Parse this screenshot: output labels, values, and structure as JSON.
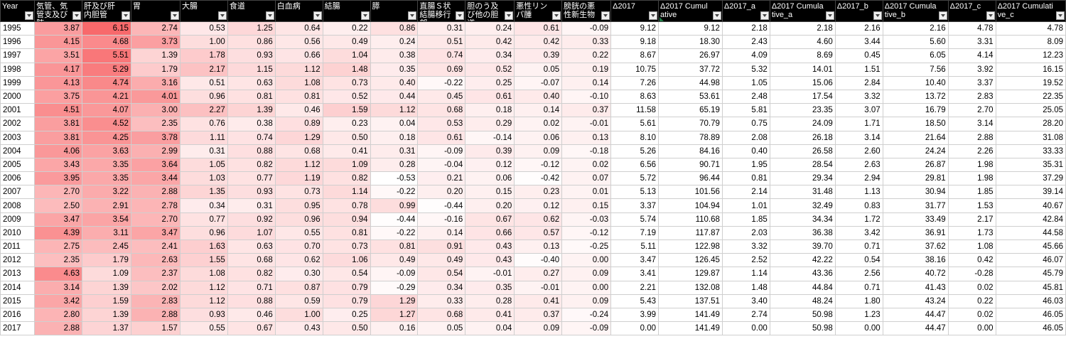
{
  "headers": [
    "Year",
    "気管、気管支及び肺",
    "肝及び肝内胆管",
    "胃",
    "大腸",
    "食道",
    "白血病",
    "結腸",
    "膵",
    "直腸Ｓ状結腸移行部",
    "胆のう及び他の胆道",
    "悪性リンパ腫",
    "膀胱の悪性新生物",
    "Δ2017",
    "Δ2017 Cumulative",
    "Δ2017_a",
    "Δ2017 Cumulative_a",
    "Δ2017_b",
    "Δ2017 Cumulative_b",
    "Δ2017_c",
    "Δ2017 Cumulative_c"
  ],
  "rows": [
    [
      "1995",
      "3.87",
      "6.15",
      "2.74",
      "0.53",
      "1.25",
      "0.64",
      "0.22",
      "0.86",
      "0.31",
      "0.24",
      "0.61",
      "-0.09",
      "9.12",
      "9.12",
      "2.18",
      "2.18",
      "2.16",
      "2.16",
      "4.78",
      "4.78"
    ],
    [
      "1996",
      "4.15",
      "4.68",
      "3.73",
      "1.00",
      "0.86",
      "0.56",
      "0.49",
      "0.24",
      "0.51",
      "0.42",
      "0.42",
      "0.33",
      "9.18",
      "18.30",
      "2.43",
      "4.60",
      "3.44",
      "5.60",
      "3.31",
      "8.09"
    ],
    [
      "1997",
      "3.51",
      "5.51",
      "1.39",
      "1.78",
      "0.93",
      "0.66",
      "1.04",
      "0.38",
      "0.74",
      "0.34",
      "0.39",
      "0.22",
      "8.67",
      "26.97",
      "4.09",
      "8.69",
      "0.45",
      "6.05",
      "4.14",
      "12.23"
    ],
    [
      "1998",
      "4.17",
      "5.29",
      "1.79",
      "2.17",
      "1.15",
      "1.12",
      "1.48",
      "0.35",
      "0.69",
      "0.52",
      "0.05",
      "0.19",
      "10.75",
      "37.72",
      "5.32",
      "14.01",
      "1.51",
      "7.56",
      "3.92",
      "16.15"
    ],
    [
      "1999",
      "4.13",
      "4.74",
      "3.16",
      "0.51",
      "0.63",
      "1.08",
      "0.73",
      "0.40",
      "-0.22",
      "0.25",
      "-0.07",
      "0.14",
      "7.26",
      "44.98",
      "1.05",
      "15.06",
      "2.84",
      "10.40",
      "3.37",
      "19.52"
    ],
    [
      "2000",
      "3.75",
      "4.21",
      "4.01",
      "0.96",
      "0.81",
      "0.81",
      "0.52",
      "0.44",
      "0.45",
      "0.61",
      "0.40",
      "-0.10",
      "8.63",
      "53.61",
      "2.48",
      "17.54",
      "3.32",
      "13.72",
      "2.83",
      "22.35"
    ],
    [
      "2001",
      "4.51",
      "4.07",
      "3.00",
      "2.27",
      "1.39",
      "0.46",
      "1.59",
      "1.12",
      "0.68",
      "0.18",
      "0.14",
      "0.37",
      "11.58",
      "65.19",
      "5.81",
      "23.35",
      "3.07",
      "16.79",
      "2.70",
      "25.05"
    ],
    [
      "2002",
      "3.81",
      "4.52",
      "2.35",
      "0.76",
      "0.38",
      "0.89",
      "0.23",
      "0.04",
      "0.53",
      "0.29",
      "0.02",
      "-0.01",
      "5.61",
      "70.79",
      "0.75",
      "24.09",
      "1.71",
      "18.50",
      "3.14",
      "28.20"
    ],
    [
      "2003",
      "3.81",
      "4.25",
      "3.78",
      "1.11",
      "0.74",
      "1.29",
      "0.50",
      "0.18",
      "0.61",
      "-0.14",
      "0.06",
      "0.13",
      "8.10",
      "78.89",
      "2.08",
      "26.18",
      "3.14",
      "21.64",
      "2.88",
      "31.08"
    ],
    [
      "2004",
      "4.06",
      "3.63",
      "2.99",
      "0.31",
      "0.88",
      "0.68",
      "0.41",
      "0.31",
      "-0.09",
      "0.39",
      "0.09",
      "-0.18",
      "5.26",
      "84.16",
      "0.40",
      "26.58",
      "2.60",
      "24.24",
      "2.26",
      "33.33"
    ],
    [
      "2005",
      "3.43",
      "3.35",
      "3.64",
      "1.05",
      "0.82",
      "1.12",
      "1.09",
      "0.28",
      "-0.04",
      "0.12",
      "-0.12",
      "0.02",
      "6.56",
      "90.71",
      "1.95",
      "28.54",
      "2.63",
      "26.87",
      "1.98",
      "35.31"
    ],
    [
      "2006",
      "3.95",
      "3.35",
      "3.44",
      "1.03",
      "0.77",
      "1.19",
      "0.82",
      "-0.53",
      "0.21",
      "0.06",
      "-0.42",
      "0.07",
      "5.72",
      "96.44",
      "0.81",
      "29.34",
      "2.94",
      "29.81",
      "1.98",
      "37.29"
    ],
    [
      "2007",
      "2.70",
      "3.22",
      "2.88",
      "1.35",
      "0.93",
      "0.73",
      "1.14",
      "-0.22",
      "0.20",
      "0.15",
      "0.23",
      "0.01",
      "5.13",
      "101.56",
      "2.14",
      "31.48",
      "1.13",
      "30.94",
      "1.85",
      "39.14"
    ],
    [
      "2008",
      "2.50",
      "2.91",
      "2.78",
      "0.34",
      "0.31",
      "0.95",
      "0.78",
      "0.99",
      "-0.44",
      "0.20",
      "0.12",
      "0.15",
      "3.37",
      "104.94",
      "1.01",
      "32.49",
      "0.83",
      "31.77",
      "1.53",
      "40.67"
    ],
    [
      "2009",
      "3.47",
      "3.54",
      "2.70",
      "0.77",
      "0.92",
      "0.96",
      "0.94",
      "-0.44",
      "-0.16",
      "0.67",
      "0.62",
      "-0.03",
      "5.74",
      "110.68",
      "1.85",
      "34.34",
      "1.72",
      "33.49",
      "2.17",
      "42.84"
    ],
    [
      "2010",
      "4.39",
      "3.11",
      "3.47",
      "0.96",
      "1.07",
      "0.55",
      "0.81",
      "-0.22",
      "0.14",
      "0.66",
      "0.57",
      "-0.12",
      "7.19",
      "117.87",
      "2.03",
      "36.38",
      "3.42",
      "36.91",
      "1.73",
      "44.58"
    ],
    [
      "2011",
      "2.75",
      "2.45",
      "2.41",
      "1.63",
      "0.63",
      "0.70",
      "0.73",
      "0.81",
      "0.91",
      "0.43",
      "0.13",
      "-0.25",
      "5.11",
      "122.98",
      "3.32",
      "39.70",
      "0.71",
      "37.62",
      "1.08",
      "45.66"
    ],
    [
      "2012",
      "2.35",
      "1.79",
      "2.63",
      "1.55",
      "0.68",
      "0.62",
      "1.06",
      "0.49",
      "0.49",
      "0.43",
      "-0.40",
      "0.00",
      "3.47",
      "126.45",
      "2.52",
      "42.22",
      "0.54",
      "38.16",
      "0.42",
      "46.07"
    ],
    [
      "2013",
      "4.63",
      "1.09",
      "2.37",
      "1.08",
      "0.82",
      "0.30",
      "0.54",
      "-0.09",
      "0.54",
      "-0.01",
      "0.27",
      "0.09",
      "3.41",
      "129.87",
      "1.14",
      "43.36",
      "2.56",
      "40.72",
      "-0.28",
      "45.79"
    ],
    [
      "2014",
      "3.14",
      "1.39",
      "2.02",
      "1.12",
      "0.71",
      "0.87",
      "0.79",
      "-0.29",
      "0.34",
      "0.35",
      "-0.01",
      "0.00",
      "2.21",
      "132.08",
      "1.48",
      "44.84",
      "0.71",
      "41.43",
      "0.02",
      "45.81"
    ],
    [
      "2015",
      "3.42",
      "1.59",
      "2.83",
      "1.12",
      "0.88",
      "0.59",
      "0.79",
      "1.29",
      "0.33",
      "0.28",
      "0.41",
      "0.09",
      "5.43",
      "137.51",
      "3.40",
      "48.24",
      "1.80",
      "43.24",
      "0.22",
      "46.03"
    ],
    [
      "2016",
      "2.80",
      "1.39",
      "2.88",
      "0.93",
      "0.46",
      "1.00",
      "0.25",
      "1.27",
      "0.68",
      "0.41",
      "0.37",
      "-0.24",
      "3.99",
      "141.49",
      "2.74",
      "50.98",
      "1.23",
      "44.47",
      "0.02",
      "46.05"
    ],
    [
      "2017",
      "2.88",
      "1.37",
      "1.57",
      "0.55",
      "0.67",
      "0.43",
      "0.50",
      "0.16",
      "0.05",
      "0.04",
      "0.09",
      "-0.09",
      "0.00",
      "141.49",
      "0.00",
      "50.98",
      "0.00",
      "44.47",
      "0.00",
      "46.05"
    ]
  ],
  "heatmap": {
    "columns": [
      1,
      2,
      3,
      4,
      5,
      6,
      7,
      8,
      9,
      10,
      11,
      12
    ],
    "min": -0.53,
    "max": 6.15,
    "color_low": "#ffffff",
    "color_high": "#f8696b"
  },
  "selection_marker_color": "#1e7b45"
}
